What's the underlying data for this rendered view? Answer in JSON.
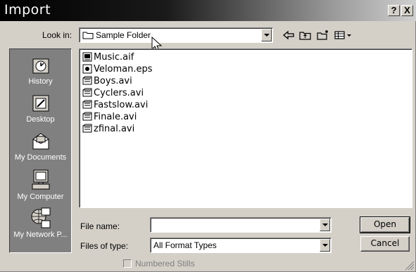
{
  "window": {
    "title": "Import"
  },
  "titlebar": {
    "help_label": "?",
    "close_label": "X"
  },
  "toolbar": {
    "look_in_label": "Look in:",
    "look_in_value": "Sample Folder",
    "icons": [
      "back-arrow-icon",
      "up-folder-icon",
      "new-folder-icon",
      "view-menu-icon"
    ]
  },
  "places": [
    {
      "label": "History",
      "icon": "history-icon"
    },
    {
      "label": "Desktop",
      "icon": "desktop-icon"
    },
    {
      "label": "My Documents",
      "icon": "my-documents-icon"
    },
    {
      "label": "My Computer",
      "icon": "my-computer-icon"
    },
    {
      "label": "My Network P...",
      "icon": "my-network-icon"
    }
  ],
  "files": [
    {
      "name": "Music.aif",
      "icon": "audio-file-icon"
    },
    {
      "name": "Veloman.eps",
      "icon": "image-file-icon"
    },
    {
      "name": "Boys.avi",
      "icon": "video-file-icon"
    },
    {
      "name": "Cyclers.avi",
      "icon": "video-file-icon"
    },
    {
      "name": "Fastslow.avi",
      "icon": "video-file-icon"
    },
    {
      "name": "Finale.avi",
      "icon": "video-file-icon"
    },
    {
      "name": "zfinal.avi",
      "icon": "video-file-icon"
    }
  ],
  "form": {
    "file_name_label": "File name:",
    "file_name_value": "",
    "files_of_type_label": "Files of type:",
    "files_of_type_value": "All Format Types",
    "numbered_stills_label": "Numbered Stills",
    "numbered_stills_checked": false
  },
  "buttons": {
    "open": "Open",
    "cancel": "Cancel"
  }
}
